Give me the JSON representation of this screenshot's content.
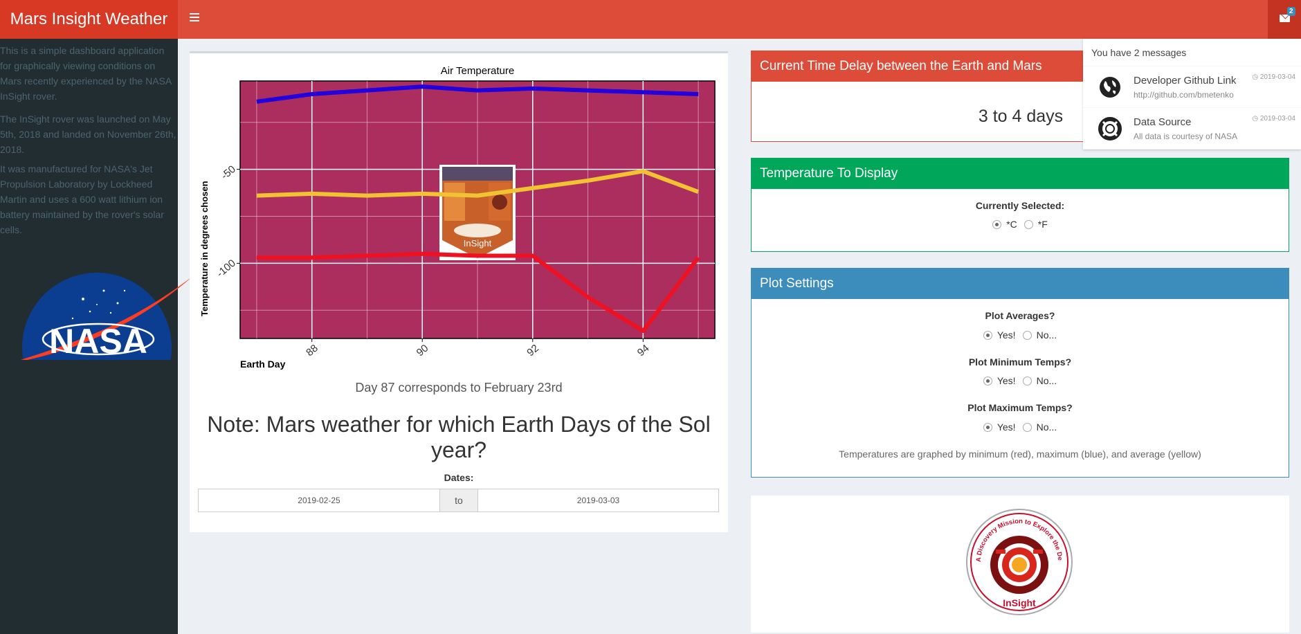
{
  "app": {
    "title": "Mars Insight Weather",
    "message_count": "2"
  },
  "sidebar": {
    "paragraphs": [
      "This is a simple dashboard application for graphically viewing conditions on Mars recently experienced by the NASA InSight rover.",
      "The InSight rover was launched on May 5th, 2018 and landed on November 26th, 2018.",
      "It was manufactured for NASA's Jet Propulsion Laboratory by Lockheed Martin and uses a 600 watt lithium ion battery maintained by the rover's solar cells."
    ],
    "logo_text": "NASA"
  },
  "chart_data": {
    "type": "line",
    "title": "Air Temperature",
    "xlabel": "Earth Day",
    "ylabel": "Temperature in degrees chosen",
    "x": [
      87,
      88,
      89,
      90,
      91,
      92,
      93,
      94,
      95
    ],
    "x_ticks": [
      "88",
      "90",
      "92",
      "94"
    ],
    "y_ticks": [
      "-50",
      "-100"
    ],
    "xlim": [
      86.7,
      95.3
    ],
    "ylim": [
      -140,
      -3
    ],
    "series": [
      {
        "color": "#2200dd",
        "values": [
          -14,
          -10,
          -8,
          -6,
          -8,
          -7,
          -8,
          -9,
          -10
        ]
      },
      {
        "color": "#f1c232",
        "values": [
          -64,
          -63,
          -64,
          -63,
          -64,
          -60,
          -56,
          -51,
          -62
        ]
      },
      {
        "color": "#ee1122",
        "values": [
          -97,
          -97,
          -96,
          -95,
          -96,
          -96,
          -118,
          -136,
          -97
        ]
      }
    ],
    "bg_color": "#ab2e5e",
    "grid": true,
    "overlay_label": "InSight"
  },
  "main": {
    "day_note": "Day 87 corresponds to February 23rd",
    "note_heading": "Note: Mars weather for which Earth Days of the Sol year?",
    "dates_label": "Dates:",
    "date_start": "2019-02-25",
    "date_sep": "to",
    "date_end": "2019-03-03"
  },
  "delay_box": {
    "title": "Current Time Delay between the Earth and Mars",
    "value": "3 to 4 days",
    "color": "#dd4b39"
  },
  "temp_box": {
    "title": "Temperature To Display",
    "label": "Currently Selected:",
    "opt_c": "*C",
    "opt_f": "*F",
    "selected": "*C",
    "color": "#00a65a"
  },
  "plot_box": {
    "title": "Plot Settings",
    "color": "#3c8dbc",
    "groups": [
      {
        "label": "Plot Averages?",
        "yes": "Yes!",
        "no": "No..."
      },
      {
        "label": "Plot Minimum Temps?",
        "yes": "Yes!",
        "no": "No..."
      },
      {
        "label": "Plot Maximum Temps?",
        "yes": "Yes!",
        "no": "No..."
      }
    ],
    "note": "Temperatures are graphed by minimum (red), maximum (blue), and average (yellow)"
  },
  "insight_logo": {
    "arc_text": "A Discovery Mission to Explore the Deep Interior of Mars",
    "bottom_text": "InSight"
  },
  "messages": {
    "header": "You have 2 messages",
    "items": [
      {
        "title": "Developer Github Link",
        "subtitle": "http://github.com/bmetenko",
        "time": "2019-03-04",
        "icon": "globe-icon"
      },
      {
        "title": "Data Source",
        "subtitle": "All data is courtesy of NASA",
        "time": "2019-03-04",
        "icon": "life-ring-icon"
      }
    ]
  }
}
